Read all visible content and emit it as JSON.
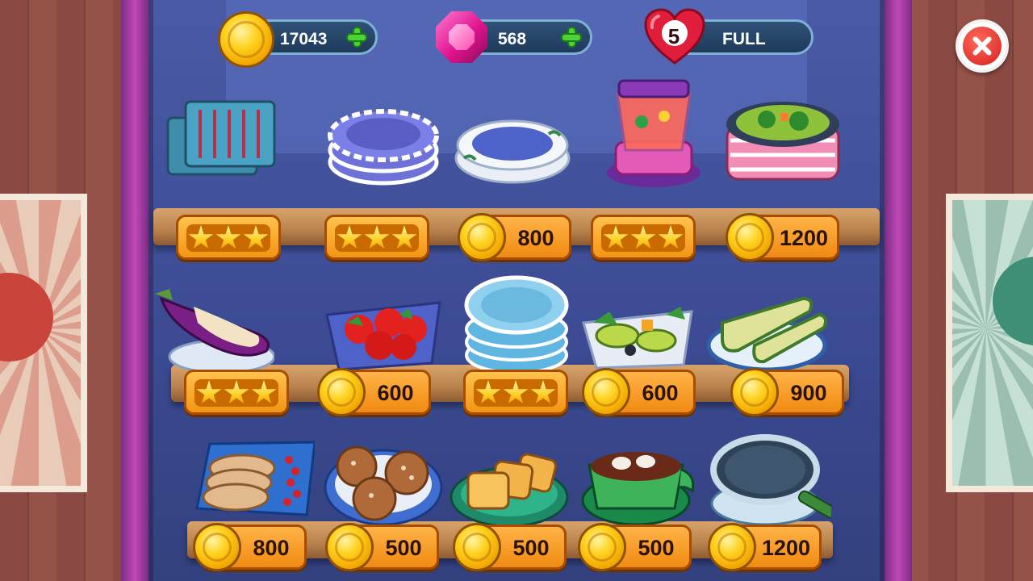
{
  "hud": {
    "coins": "17043",
    "gems": "568",
    "lives_count": "5",
    "lives_status": "FULL"
  },
  "colors": {
    "accent_orange": "#f08a12",
    "hud_pill": "#1e3a5b",
    "plus_green": "#4cd437",
    "close_red": "#d61f1f"
  },
  "shelves": [
    {
      "items": [
        {
          "name": "grill-rack",
          "icon": "grill-rack-icon",
          "kind": "upgrade",
          "stars": 3
        },
        {
          "name": "purple-plates",
          "icon": "purple-plates-icon",
          "kind": "upgrade",
          "stars": 3
        },
        {
          "name": "white-plates",
          "icon": "white-plates-icon",
          "kind": "buy",
          "price": "800"
        },
        {
          "name": "blender",
          "icon": "blender-icon",
          "kind": "upgrade",
          "stars": 3
        },
        {
          "name": "soup-pot",
          "icon": "soup-pot-icon",
          "kind": "buy",
          "price": "1200"
        }
      ]
    },
    {
      "items": [
        {
          "name": "eggplant",
          "icon": "eggplant-icon",
          "kind": "upgrade",
          "stars": 3
        },
        {
          "name": "tomatoes",
          "icon": "tomatoes-icon",
          "kind": "buy",
          "price": "600"
        },
        {
          "name": "blue-plates",
          "icon": "blue-plates-icon",
          "kind": "upgrade",
          "stars": 3
        },
        {
          "name": "avocado-salad",
          "icon": "avocado-salad-icon",
          "kind": "buy",
          "price": "600"
        },
        {
          "name": "zucchini",
          "icon": "zucchini-icon",
          "kind": "buy",
          "price": "900"
        }
      ]
    },
    {
      "items": [
        {
          "name": "bread-tray",
          "icon": "bread-tray-icon",
          "kind": "buy",
          "price": "800"
        },
        {
          "name": "meatballs",
          "icon": "meatballs-icon",
          "kind": "buy",
          "price": "500"
        },
        {
          "name": "toast",
          "icon": "toast-icon",
          "kind": "buy",
          "price": "500"
        },
        {
          "name": "mushroom-soup",
          "icon": "mushroom-soup-icon",
          "kind": "buy",
          "price": "500"
        },
        {
          "name": "frying-pan",
          "icon": "frying-pan-icon",
          "kind": "buy",
          "price": "1200"
        }
      ]
    }
  ]
}
